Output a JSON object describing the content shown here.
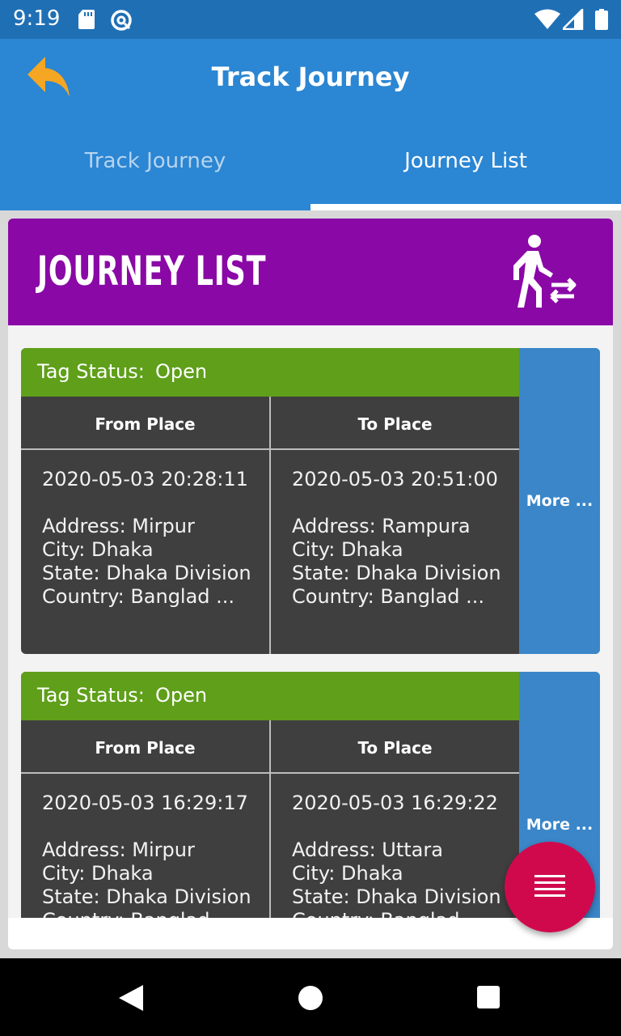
{
  "status_bar": {
    "time": "9:19",
    "icons": [
      "sd-card-icon",
      "at-sign-icon",
      "wifi-icon",
      "signal-icon",
      "battery-icon"
    ]
  },
  "app_bar": {
    "title": "Track Journey",
    "back_icon": "back-arrow-icon",
    "tabs": [
      {
        "label": "Track Journey",
        "selected": false
      },
      {
        "label": "Journey List",
        "selected": true
      }
    ]
  },
  "banner": {
    "title": "JOURNEY LIST",
    "icon": "walking-transfer-icon"
  },
  "journeys": [
    {
      "tag_label": "Tag Status:",
      "tag_value": "Open",
      "from_header": "From Place",
      "to_header": "To Place",
      "more_label": "More ...",
      "from": {
        "datetime": "2020-05-03 20:28:11",
        "address": "Address: Mirpur",
        "city": "City: Dhaka",
        "state": "State: Dhaka Division",
        "country": "Country: Banglad ..."
      },
      "to": {
        "datetime": "2020-05-03 20:51:00",
        "address": "Address: Rampura",
        "city": "City: Dhaka",
        "state": "State: Dhaka Division",
        "country": "Country: Banglad ..."
      }
    },
    {
      "tag_label": "Tag Status:",
      "tag_value": "Open",
      "from_header": "From Place",
      "to_header": "To Place",
      "more_label": "More ...",
      "from": {
        "datetime": "2020-05-03 16:29:17",
        "address": "Address: Mirpur",
        "city": "City: Dhaka",
        "state": "State: Dhaka Division",
        "country": "Country: Banglad ..."
      },
      "to": {
        "datetime": "2020-05-03 16:29:22",
        "address": "Address: Uttara",
        "city": "City: Dhaka",
        "state": "State: Dhaka Division",
        "country": "Country: Banglad ..."
      }
    }
  ],
  "fab": {
    "icon": "menu-lines-icon"
  },
  "nav_bar": {
    "icons": [
      "nav-back-icon",
      "nav-home-icon",
      "nav-recents-icon"
    ]
  },
  "colors": {
    "status_bar": "#1f6fb5",
    "app_bar": "#2b86d3",
    "banner": "#8a08a6",
    "tag_bar": "#5f9f1a",
    "card_body": "#3f3f3f",
    "more_column": "#3a86c8",
    "fab": "#d0094d"
  }
}
